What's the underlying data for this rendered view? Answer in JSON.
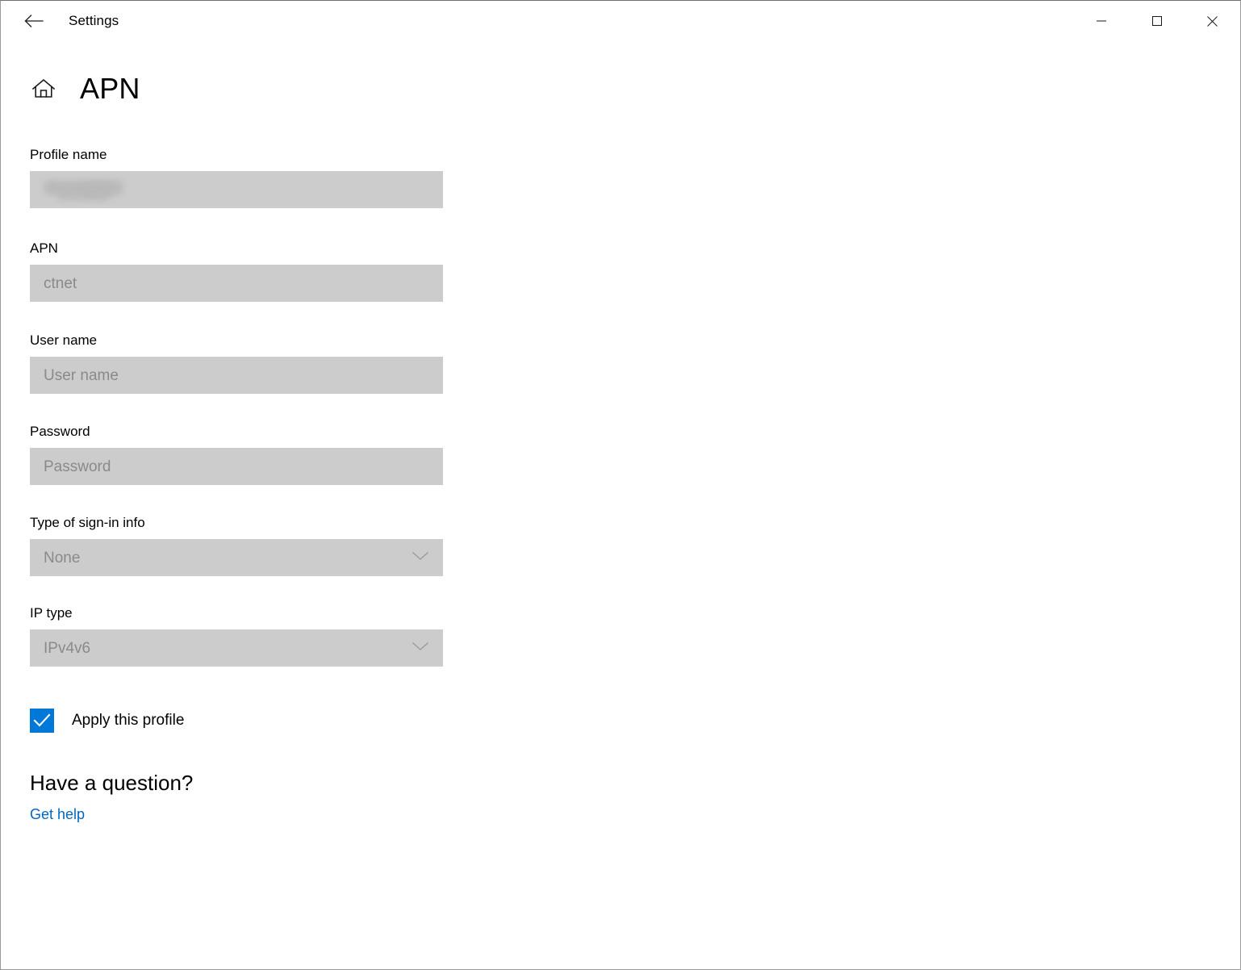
{
  "window": {
    "titlebar_title": "Settings",
    "back_icon": "back-arrow-icon",
    "minimize_label": "—",
    "maximize_label": "□",
    "close_label": "✕"
  },
  "page": {
    "home_icon": "home-icon",
    "title": "APN"
  },
  "form": {
    "fields": [
      {
        "label": "Profile name",
        "value": "",
        "redacted": true,
        "type": "text"
      },
      {
        "label": "APN",
        "value": "ctnet",
        "redacted": false,
        "type": "text"
      },
      {
        "label": "User name",
        "value": "User name",
        "redacted": false,
        "type": "text"
      },
      {
        "label": "Password",
        "value": "Password",
        "redacted": false,
        "type": "password"
      },
      {
        "label": "Type of sign-in info",
        "value": "None",
        "redacted": false,
        "type": "select",
        "icon": "chevron-down-icon"
      },
      {
        "label": "IP type",
        "value": "IPv4v6",
        "redacted": false,
        "type": "select",
        "icon": "chevron-down-icon"
      }
    ]
  },
  "apply_profile": {
    "label": "Apply this profile",
    "checked": true,
    "accent_color": "#0078d7",
    "check_icon": "checkmark-icon"
  },
  "help": {
    "heading": "Have a question?",
    "link_label": "Get help",
    "link_color": "#0067c0"
  }
}
